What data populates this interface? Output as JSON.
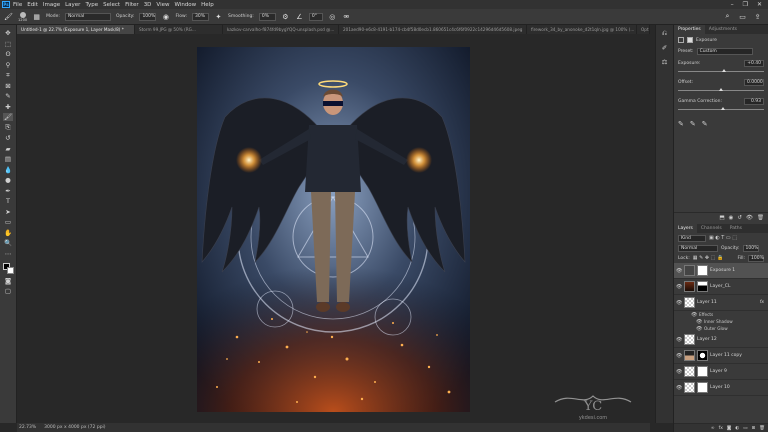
{
  "menu": {
    "items": [
      "File",
      "Edit",
      "Image",
      "Layer",
      "Type",
      "Select",
      "Filter",
      "3D",
      "View",
      "Window",
      "Help"
    ],
    "window_controls": [
      "–",
      "❐",
      "✕"
    ]
  },
  "options_bar": {
    "brush_size": "1200",
    "mode_label": "Mode:",
    "mode_value": "Normal",
    "opacity_label": "Opacity:",
    "opacity_value": "100%",
    "flow_label": "Flow:",
    "flow_value": "30%",
    "smoothing_label": "Smoothing:",
    "smoothing_value": "0%",
    "angle_value": "0°"
  },
  "tabs": [
    {
      "label": "Untitled-1 @ 22.7% (Exposure 1, Layer Mask/8) *",
      "active": true
    },
    {
      "label": "Storm 99.JPG @ 50% (RG...",
      "active": false
    },
    {
      "label": "kazkov-carvalho-f874fd9bygYQQ-unsplash.psd @...",
      "active": false
    },
    {
      "label": "201aed90-e6c8-4191-b174-cb4f58d0ecb1.860651c4c6f6f0922c14296d46d5608.jpeg",
      "active": false
    },
    {
      "label": "firework_34_by_anonoke_d2t1qln.jpg @ 100% (...",
      "active": false
    },
    {
      "label": "Opti",
      "active": false
    }
  ],
  "status": {
    "zoom": "22.73%",
    "doc_size": "3000 px x 4000 px (72 ppi)"
  },
  "properties": {
    "tabs": [
      "Properties",
      "Adjustments"
    ],
    "panel_title": "Exposure",
    "preset_label": "Preset:",
    "preset_value": "Custom",
    "exposure_label": "Exposure:",
    "exposure_value": "+0.40",
    "exposure_level": 0.54,
    "offset_label": "Offset:",
    "offset_value": "0.0000",
    "offset_level": 0.5,
    "gamma_label": "Gamma Correction:",
    "gamma_value": "0.93",
    "gamma_level": 0.52
  },
  "layers_panel": {
    "tabs": [
      "Layers",
      "Channels",
      "Paths"
    ],
    "kind_label": "Kind",
    "blend_mode": "Normal",
    "opacity_label": "Opacity:",
    "opacity_value": "100%",
    "lock_label": "Lock:",
    "fill_label": "Fill:",
    "fill_value": "100%",
    "layers": [
      {
        "name": "Exposure 1",
        "selected": true
      },
      {
        "name": "Layer_CL",
        "selected": false
      },
      {
        "name": "Layer 11",
        "selected": false,
        "fx": "fx"
      },
      {
        "name": "Layer 12",
        "selected": false
      },
      {
        "name": "Layer 11 copy",
        "selected": false
      },
      {
        "name": "Layer 9",
        "selected": false
      },
      {
        "name": "Layer 10",
        "selected": false
      }
    ],
    "effects_label": "Effects",
    "effect_items": [
      "Inner Shadow",
      "Outer Glow"
    ]
  },
  "watermark": {
    "logo_text": "YC",
    "site_text": "ykdesi.com"
  }
}
